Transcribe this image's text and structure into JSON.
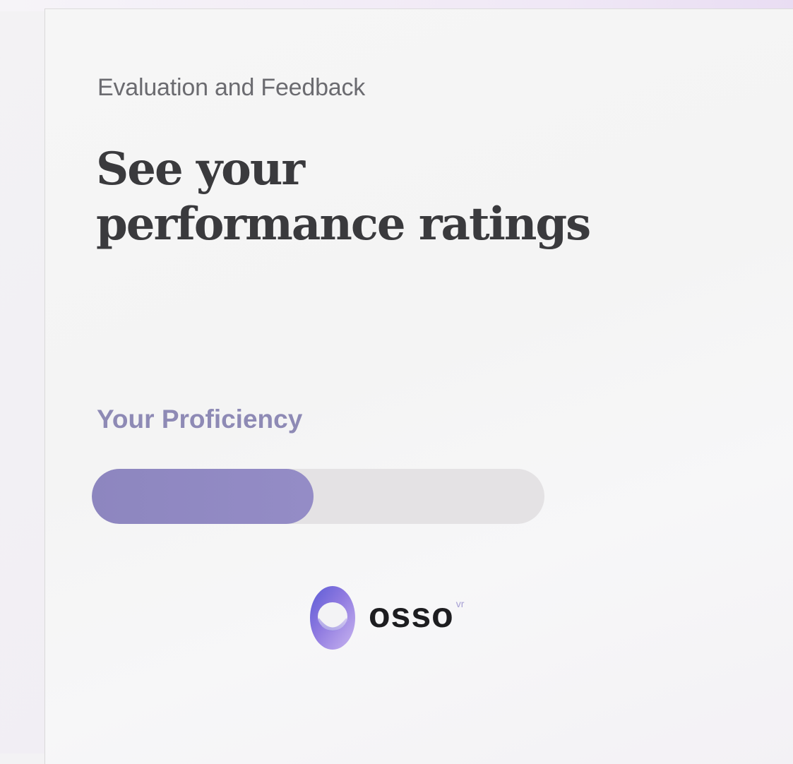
{
  "header": {
    "eyebrow": "Evaluation and Feedback",
    "headline_line1": "See your",
    "headline_line2": "performance ratings"
  },
  "proficiency": {
    "label": "Your Proficiency",
    "progress_fraction": 0.49
  },
  "brand": {
    "name": "osso",
    "superscript": "vr",
    "logo_icon": "osso-ring-logo-icon"
  },
  "colors": {
    "accent": "#8e8ab5",
    "progress_fill": "#8d86bf",
    "progress_track": "#e4e2e4",
    "heading": "#3a3a3d"
  }
}
